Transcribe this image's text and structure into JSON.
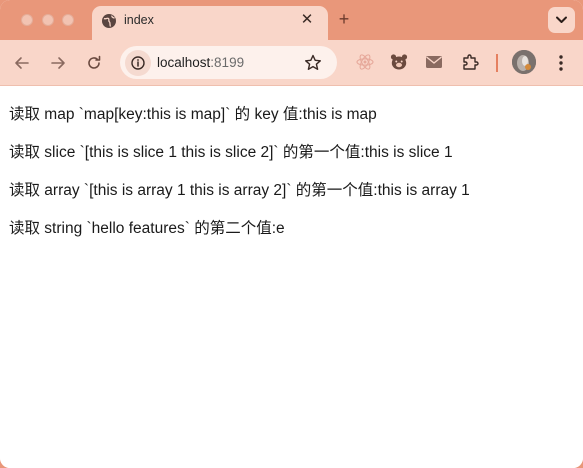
{
  "browser": {
    "tab": {
      "title": "index",
      "favicon": "globe-icon",
      "close_icon": "close-icon"
    },
    "new_tab_icon": "plus-icon",
    "tab_search_icon": "chevron-down-icon",
    "toolbar": {
      "back_icon": "arrow-left-icon",
      "forward_icon": "arrow-right-icon",
      "reload_icon": "reload-icon",
      "site_info_icon": "site-info-icon",
      "url_host": "localhost",
      "url_port": ":8199",
      "bookmark_icon": "star-icon",
      "extensions": [
        "react-devtools-icon",
        "bear-extension-icon",
        "mail-extension-icon",
        "puzzle-extensions-icon"
      ],
      "profile_icon": "avatar",
      "menu_icon": "more-vertical-icon"
    },
    "colors": {
      "frame": "#e9977a",
      "toolbar": "#f9d6c9",
      "omnibox": "#fdf1ec"
    }
  },
  "page": {
    "lines": [
      "读取 map `map[key:this is map]` 的 key 值:this is map",
      "读取 slice `[this is slice 1 this is slice 2]` 的第一个值:this is slice 1",
      "读取 array `[this is array 1 this is array 2]` 的第一个值:this is array 1",
      "读取 string `hello features` 的第二个值:e"
    ]
  }
}
